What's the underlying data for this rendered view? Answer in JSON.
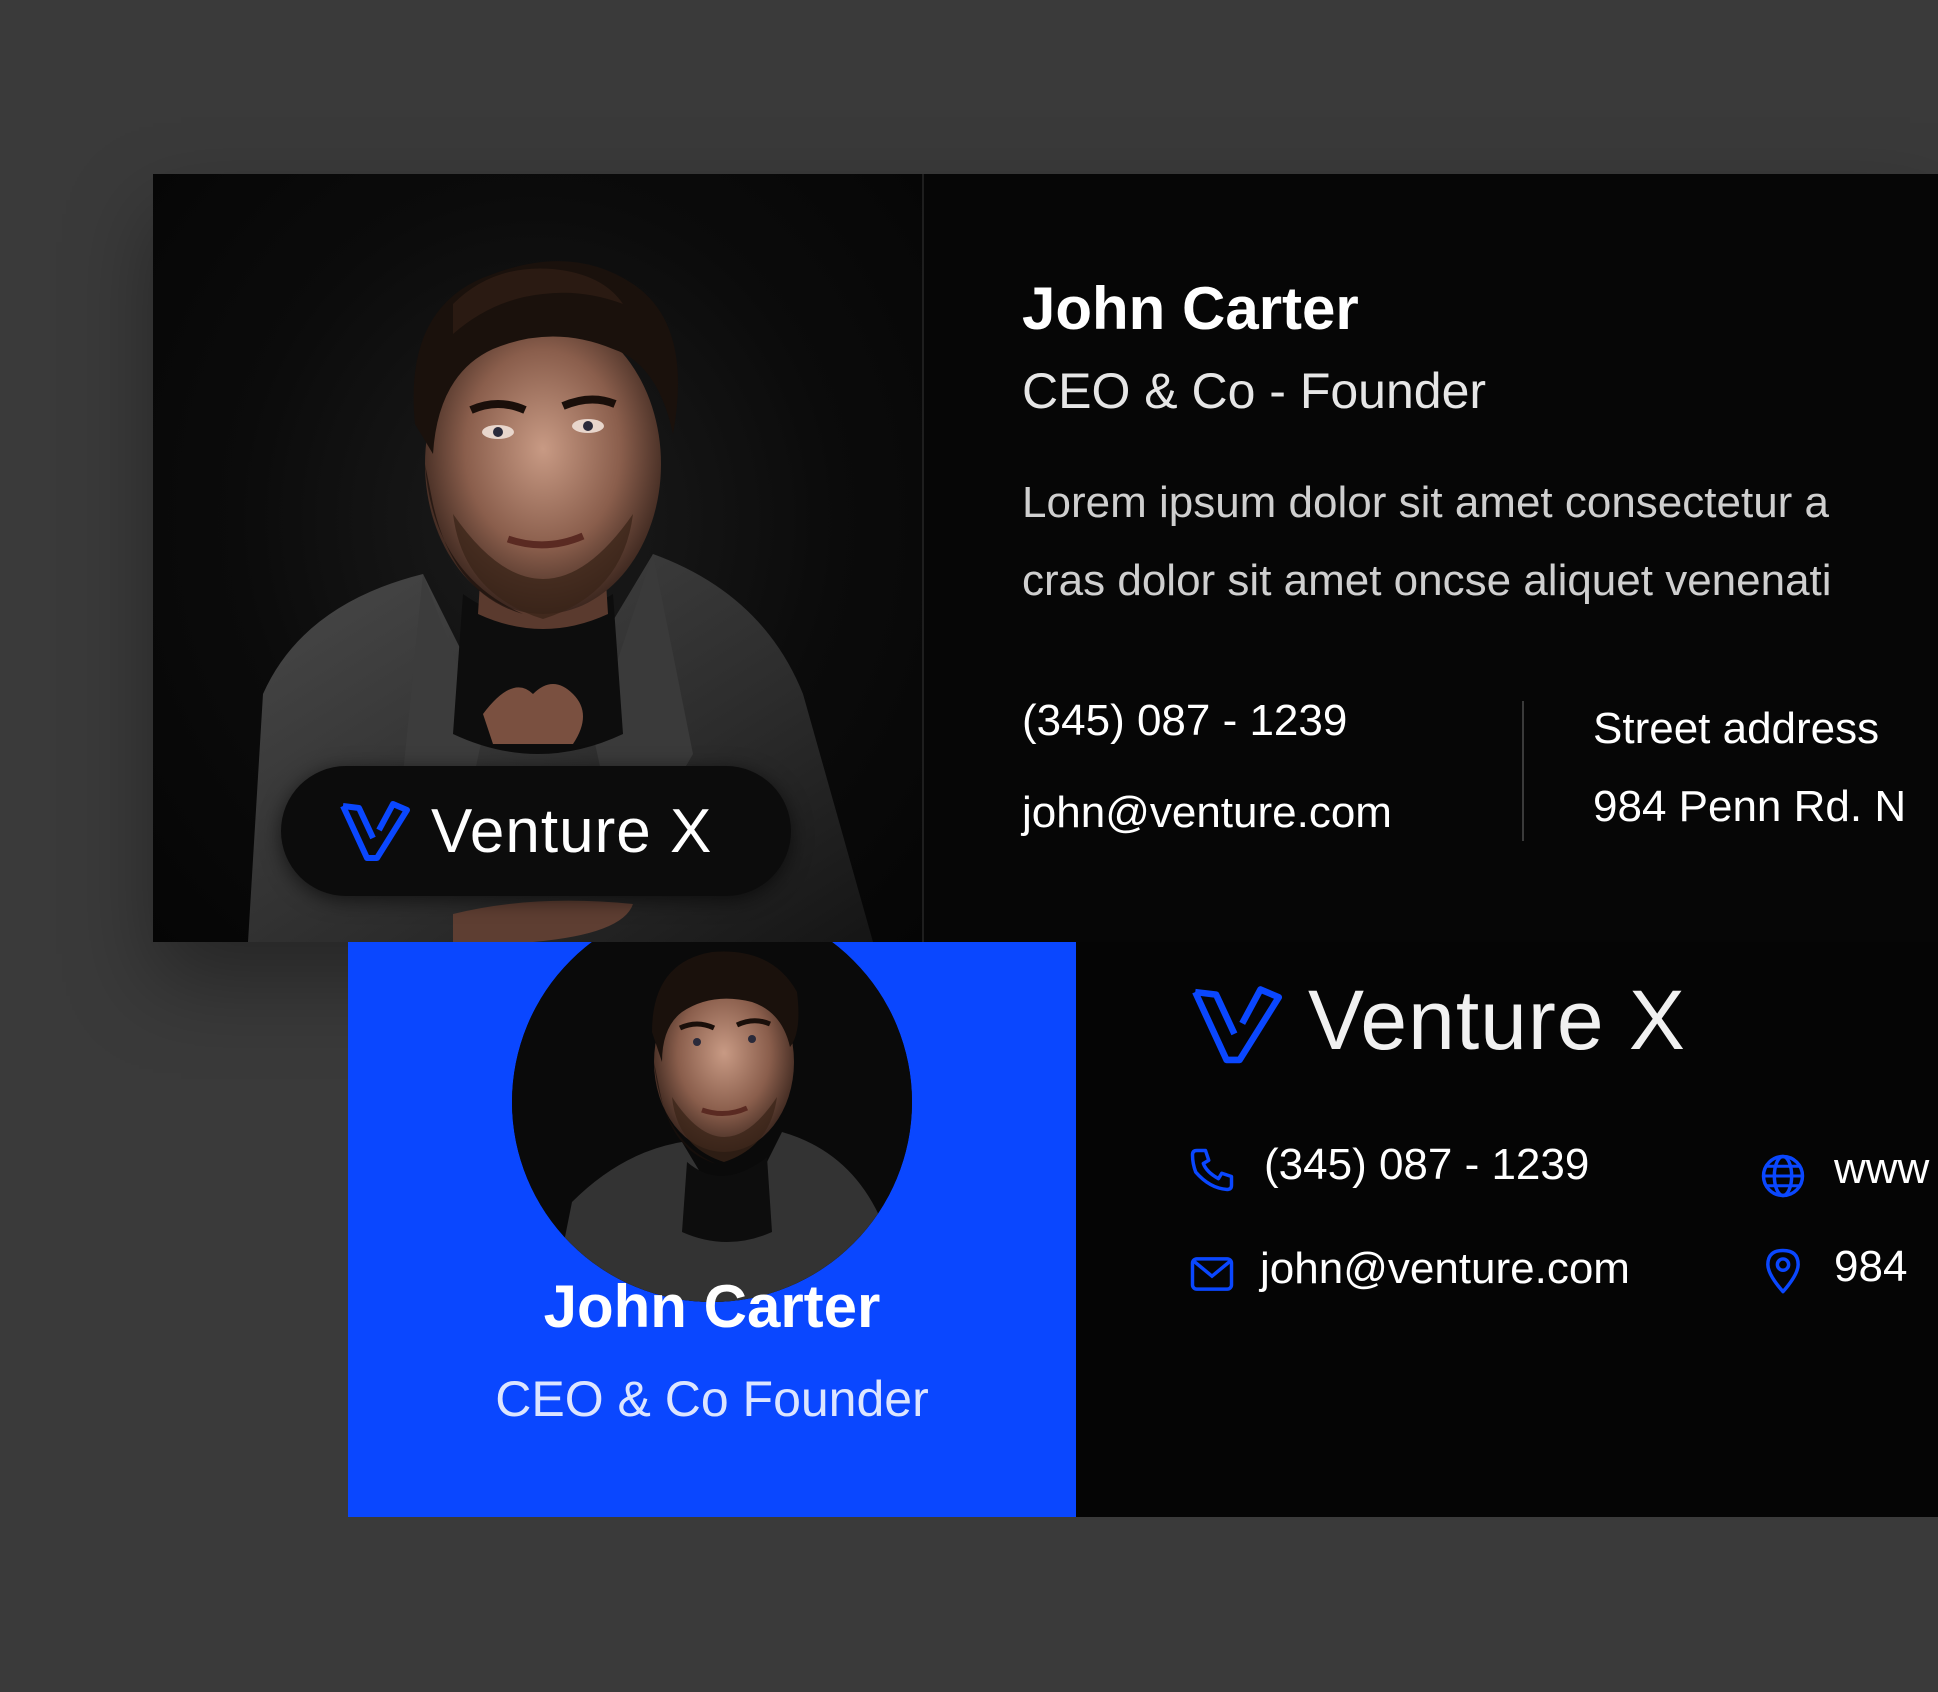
{
  "colors": {
    "background": "#3a3a3a",
    "card_dark": "#060606",
    "accent_blue": "#0a47ff"
  },
  "card_top": {
    "brand": "Venture X",
    "name": "John Carter",
    "role": "CEO & Co - Founder",
    "bio_lines": [
      "Lorem ipsum dolor sit amet consectetur a",
      "cras dolor sit amet oncse aliquet venenati"
    ],
    "phone": "(345) 087 - 1239",
    "email": "john@venture.com",
    "street_label": "Street address",
    "street": "984 Penn Rd. N"
  },
  "card_bottom": {
    "brand": "Venture X",
    "name": "John Carter",
    "role": "CEO & Co Founder",
    "phone": "(345) 087 - 1239",
    "email": "john@venture.com",
    "website": "www",
    "address": "984",
    "icons": [
      "phone-icon",
      "mail-icon",
      "globe-icon",
      "location-pin-icon"
    ]
  }
}
